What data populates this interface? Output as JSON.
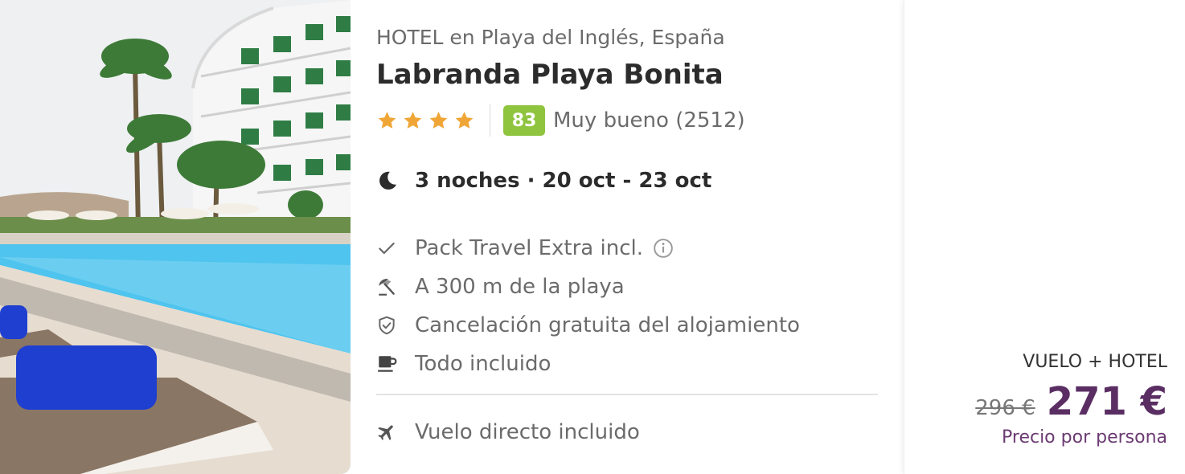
{
  "hotel": {
    "subtitle": "HOTEL en Playa del Inglés, España",
    "name": "Labranda Playa Bonita",
    "stars": 4,
    "score": "83",
    "review_text": "Muy bueno (2512)"
  },
  "stay": {
    "dates": "3 noches · 20 oct - 23 oct"
  },
  "features": [
    {
      "icon": "check-icon",
      "label": "Pack Travel Extra incl."
    },
    {
      "icon": "beach-umbrella-icon",
      "label": "A 300 m de la playa"
    },
    {
      "icon": "shield-check-icon",
      "label": "Cancelación gratuita del alojamiento"
    },
    {
      "icon": "coffee-cup-icon",
      "label": "Todo incluido"
    }
  ],
  "flight": {
    "label": "Vuelo directo incluido"
  },
  "price": {
    "pack_type": "VUELO + HOTEL",
    "old_price": "296 €",
    "new_price": "271 €",
    "per_person": "Precio por persona"
  },
  "colors": {
    "score_bg": "#8fc43f",
    "star": "#f0a637",
    "price": "#5a2e63"
  }
}
